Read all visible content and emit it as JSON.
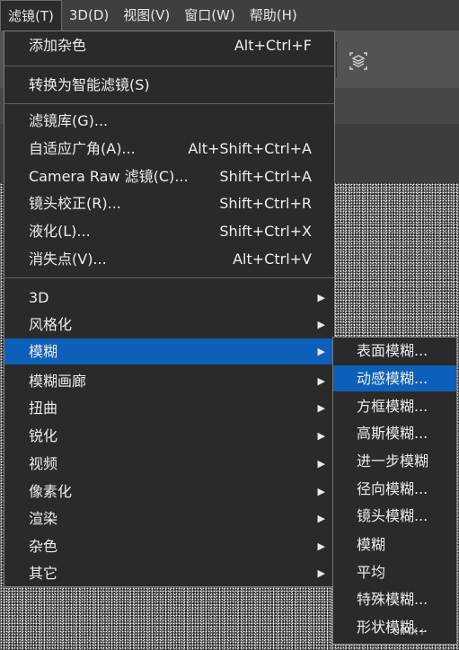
{
  "menubar": [
    {
      "label": "滤镜(T)",
      "active": true
    },
    {
      "label": "3D(D)"
    },
    {
      "label": "视图(V)"
    },
    {
      "label": "窗口(W)"
    },
    {
      "label": "帮助(H)"
    }
  ],
  "menu": [
    {
      "label": "添加杂色",
      "shortcut": "Alt+Ctrl+F"
    },
    {
      "label": "转换为智能滤镜(S)",
      "shortcut": ""
    },
    {
      "label": "滤镜库(G)...",
      "shortcut": ""
    },
    {
      "label": "自适应广角(A)...",
      "shortcut": "Alt+Shift+Ctrl+A"
    },
    {
      "label": "Camera Raw 滤镜(C)...",
      "shortcut": "Shift+Ctrl+A"
    },
    {
      "label": "镜头校正(R)...",
      "shortcut": "Shift+Ctrl+R"
    },
    {
      "label": "液化(L)...",
      "shortcut": "Shift+Ctrl+X"
    },
    {
      "label": "消失点(V)...",
      "shortcut": "Alt+Ctrl+V"
    },
    {
      "label": "3D",
      "submenu": true
    },
    {
      "label": "风格化",
      "submenu": true
    },
    {
      "label": "模糊",
      "submenu": true,
      "highlighted": true
    },
    {
      "label": "模糊画廊",
      "submenu": true
    },
    {
      "label": "扭曲",
      "submenu": true
    },
    {
      "label": "锐化",
      "submenu": true
    },
    {
      "label": "视频",
      "submenu": true
    },
    {
      "label": "像素化",
      "submenu": true
    },
    {
      "label": "渲染",
      "submenu": true
    },
    {
      "label": "杂色",
      "submenu": true
    },
    {
      "label": "其它",
      "submenu": true
    }
  ],
  "submenu": [
    {
      "label": "表面模糊..."
    },
    {
      "label": "动感模糊...",
      "highlighted": true
    },
    {
      "label": "方框模糊..."
    },
    {
      "label": "高斯模糊..."
    },
    {
      "label": "进一步模糊"
    },
    {
      "label": "径向模糊..."
    },
    {
      "label": "镜头模糊..."
    },
    {
      "label": "模糊"
    },
    {
      "label": "平均"
    },
    {
      "label": "特殊模糊..."
    },
    {
      "label": "形状模糊..."
    }
  ],
  "watermark": "UIMX+",
  "icons": {
    "arrow": "▶",
    "toolbar": "layers-icon"
  },
  "colors": {
    "highlight": "#0d60b9",
    "menu_bg": "#2a2a2a"
  }
}
